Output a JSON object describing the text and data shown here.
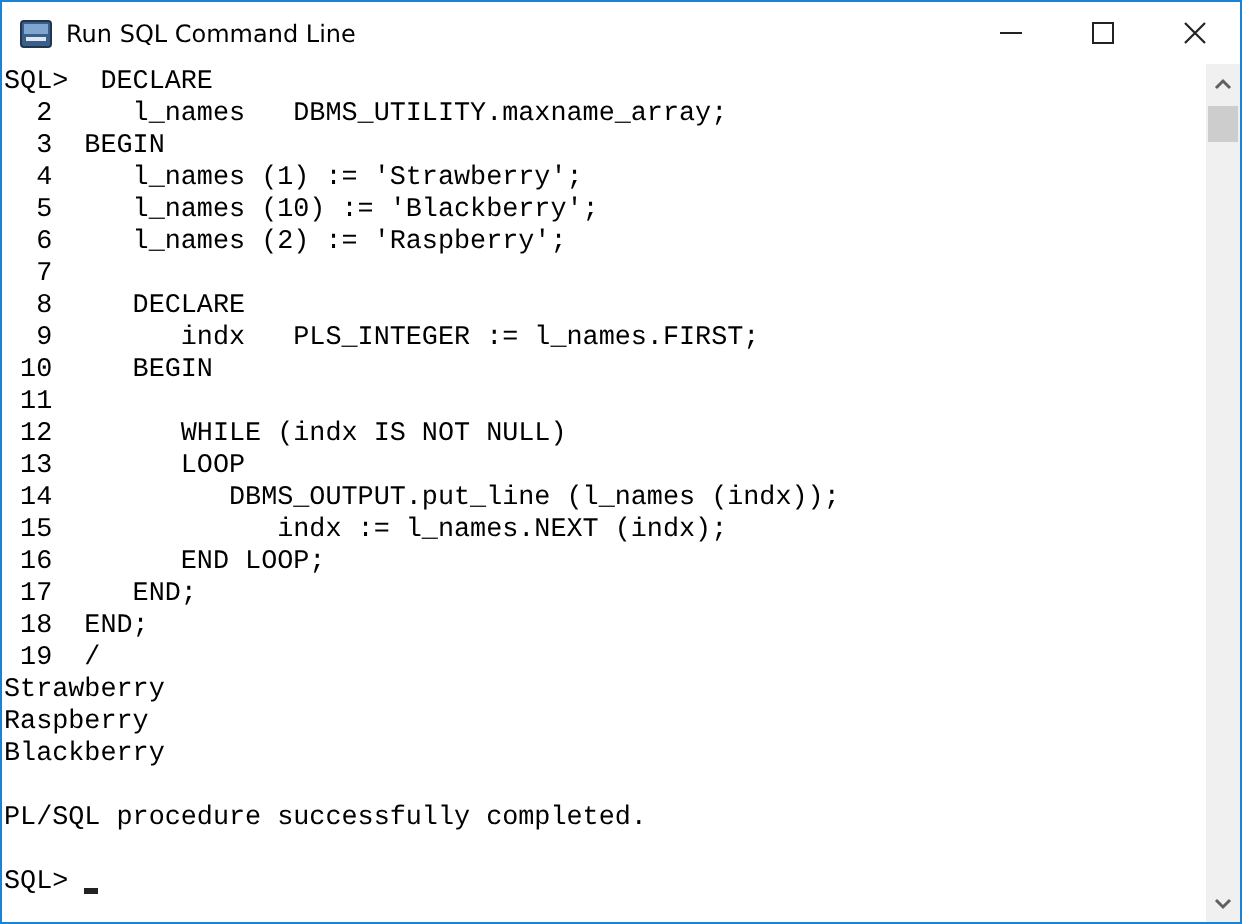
{
  "window": {
    "title": "Run SQL Command Line"
  },
  "console": {
    "blocks": [
      [
        "SQL>  DECLARE",
        "  2     l_names   DBMS_UTILITY.maxname_array;",
        "  3  BEGIN",
        "  4     l_names (1) := 'Strawberry';",
        "  5     l_names (10) := 'Blackberry';",
        "  6     l_names (2) := 'Raspberry';",
        "  7",
        "  8     DECLARE",
        "  9        indx   PLS_INTEGER := l_names.FIRST;",
        " 10     BEGIN",
        " 11",
        " 12        WHILE (indx IS NOT NULL)",
        " 13        LOOP",
        " 14           DBMS_OUTPUT.put_line (l_names (indx));",
        " 15              indx := l_names.NEXT (indx);",
        " 16        END LOOP;",
        " 17     END;",
        " 18  END;",
        " 19  /",
        "Strawberry",
        "Raspberry",
        "Blackberry"
      ],
      [
        "PL/SQL procedure successfully completed."
      ]
    ],
    "prompt": {
      "text": "SQL>",
      "cursor": true
    }
  }
}
